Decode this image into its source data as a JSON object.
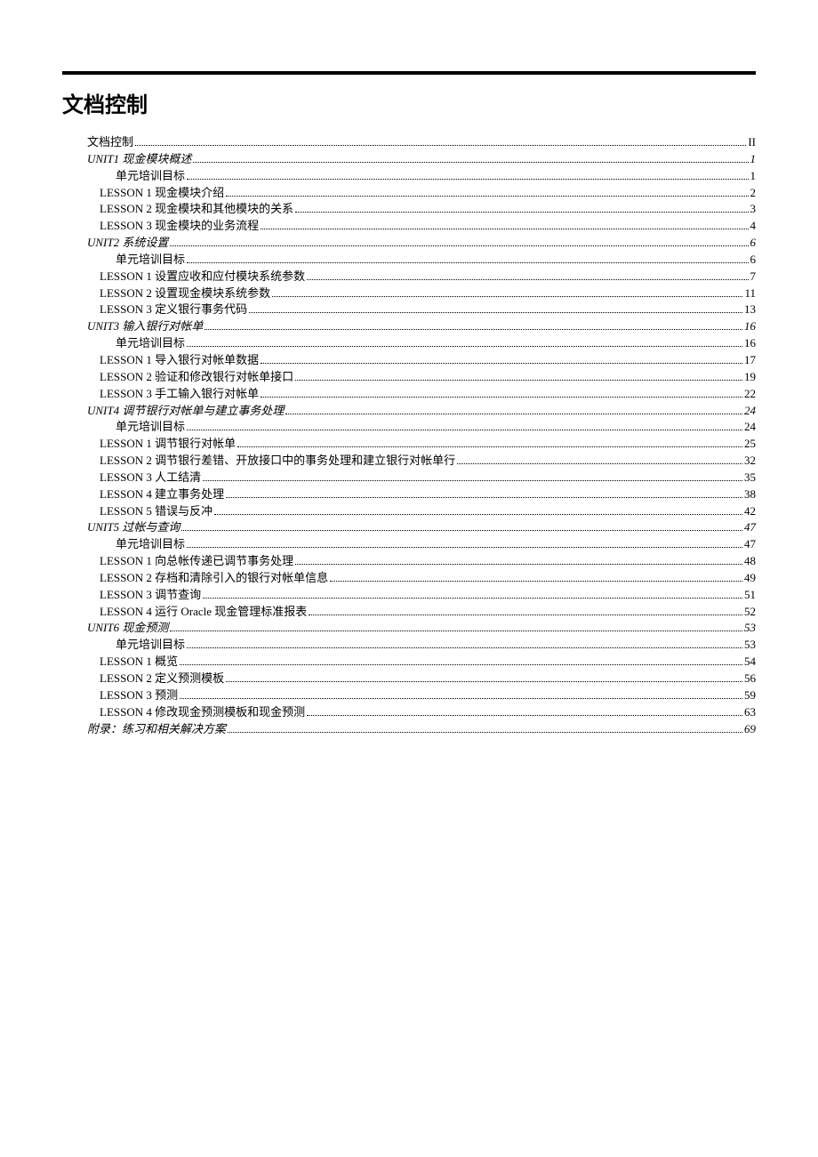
{
  "heading": "文档控制",
  "toc": [
    {
      "label": "文档控制",
      "page": "II",
      "indent": 1,
      "italic": false
    },
    {
      "label": "UNIT1   现金模块概述",
      "page": "1",
      "indent": 1,
      "italic": true
    },
    {
      "label": "单元培训目标",
      "page": "1",
      "indent": 3,
      "italic": false
    },
    {
      "label": "LESSON 1  现金模块介绍",
      "page": "2",
      "indent": 2,
      "italic": false
    },
    {
      "label": "LESSON 2  现金模块和其他模块的关系",
      "page": "3",
      "indent": 2,
      "italic": false
    },
    {
      "label": "LESSON 3  现金模块的业务流程",
      "page": "4",
      "indent": 2,
      "italic": false
    },
    {
      "label": "UNIT2   系统设置",
      "page": "6",
      "indent": 1,
      "italic": true
    },
    {
      "label": "单元培训目标",
      "page": "6",
      "indent": 3,
      "italic": false
    },
    {
      "label": "LESSON 1  设置应收和应付模块系统参数",
      "page": "7",
      "indent": 2,
      "italic": false
    },
    {
      "label": "LESSON 2  设置现金模块系统参数",
      "page": "11",
      "indent": 2,
      "italic": false
    },
    {
      "label": "LESSON 3  定义银行事务代码",
      "page": "13",
      "indent": 2,
      "italic": false
    },
    {
      "label": "UNIT3   输入银行对帐单",
      "page": "16",
      "indent": 1,
      "italic": true
    },
    {
      "label": "单元培训目标",
      "page": "16",
      "indent": 3,
      "italic": false
    },
    {
      "label": "LESSON 1  导入银行对帐单数据",
      "page": "17",
      "indent": 2,
      "italic": false
    },
    {
      "label": "LESSON 2  验证和修改银行对帐单接口",
      "page": "19",
      "indent": 2,
      "italic": false
    },
    {
      "label": "LESSON 3  手工输入银行对帐单",
      "page": "22",
      "indent": 2,
      "italic": false
    },
    {
      "label": "UNIT4   调节银行对帐单与建立事务处理",
      "page": "24",
      "indent": 1,
      "italic": true
    },
    {
      "label": "单元培训目标",
      "page": "24",
      "indent": 3,
      "italic": false
    },
    {
      "label": "LESSON 1  调节银行对帐单",
      "page": "25",
      "indent": 2,
      "italic": false
    },
    {
      "label": "LESSON 2  调节银行差错、开放接口中的事务处理和建立银行对帐单行",
      "page": "32",
      "indent": 2,
      "italic": false
    },
    {
      "label": "LESSON 3  人工结清",
      "page": "35",
      "indent": 2,
      "italic": false
    },
    {
      "label": "LESSON 4  建立事务处理",
      "page": "38",
      "indent": 2,
      "italic": false
    },
    {
      "label": "LESSON 5  错误与反冲",
      "page": "42",
      "indent": 2,
      "italic": false
    },
    {
      "label": "UNIT5   过帐与查询",
      "page": "47",
      "indent": 1,
      "italic": true
    },
    {
      "label": "单元培训目标",
      "page": "47",
      "indent": 3,
      "italic": false
    },
    {
      "label": "LESSON 1  向总帐传递已调节事务处理",
      "page": "48",
      "indent": 2,
      "italic": false
    },
    {
      "label": "LESSON 2  存档和清除引入的银行对帐单信息",
      "page": "49",
      "indent": 2,
      "italic": false
    },
    {
      "label": "LESSON 3  调节查询",
      "page": "51",
      "indent": 2,
      "italic": false
    },
    {
      "label": "LESSON 4  运行 Oracle 现金管理标准报表",
      "page": "52",
      "indent": 2,
      "italic": false
    },
    {
      "label": "UNIT6   现金预测",
      "page": "53",
      "indent": 1,
      "italic": true
    },
    {
      "label": "单元培训目标",
      "page": "53",
      "indent": 3,
      "italic": false
    },
    {
      "label": "LESSON 1  概览",
      "page": "54",
      "indent": 2,
      "italic": false
    },
    {
      "label": "LESSON 2  定义预测模板",
      "page": "56",
      "indent": 2,
      "italic": false
    },
    {
      "label": "LESSON 3  预测",
      "page": "59",
      "indent": 2,
      "italic": false
    },
    {
      "label": "LESSON 4  修改现金预测模板和现金预测",
      "page": "63",
      "indent": 2,
      "italic": false
    },
    {
      "label": "附录：练习和相关解决方案",
      "page": "69",
      "indent": 1,
      "italic": true
    }
  ]
}
